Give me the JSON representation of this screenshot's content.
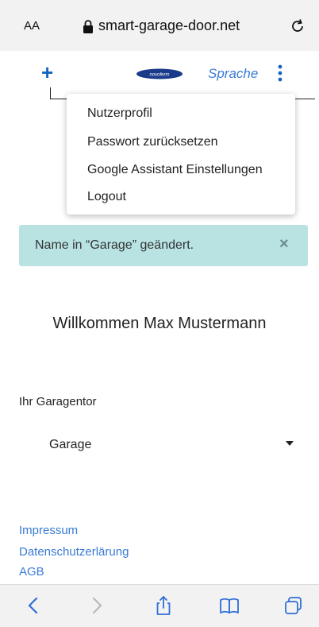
{
  "browser": {
    "text_size_label": "AA",
    "host": "smart-garage-door.net",
    "icons": [
      "lock-icon",
      "reload-icon"
    ]
  },
  "header": {
    "add_label": "+",
    "logo_text": "novoferm",
    "language_label": "Sprache",
    "icons": [
      "plus-icon",
      "kebab-menu-icon"
    ]
  },
  "menu": {
    "items": [
      {
        "label": "Nutzerprofil"
      },
      {
        "label": "Passwort zurücksetzen"
      },
      {
        "label": "Google Assistant Einstellungen"
      },
      {
        "label": "Logout"
      }
    ]
  },
  "alert": {
    "text": "Name in “Garage” geändert.",
    "close_label": "×"
  },
  "main": {
    "welcome": "Willkommen Max Mustermann",
    "gate_label": "Ihr Garagentor",
    "gate_selected": "Garage"
  },
  "footer": {
    "links": [
      {
        "label": "Impressum"
      },
      {
        "label": "Datenschutzerlärung"
      },
      {
        "label": "AGB"
      }
    ]
  },
  "toolbar": {
    "icons": [
      "back-icon",
      "forward-icon",
      "share-icon",
      "bookmarks-icon",
      "tabs-icon"
    ]
  },
  "colors": {
    "accent": "#3a7bd5",
    "plus": "#1565c0",
    "alert_bg": "#b9e3e3",
    "logo": "#1a3a8a"
  }
}
